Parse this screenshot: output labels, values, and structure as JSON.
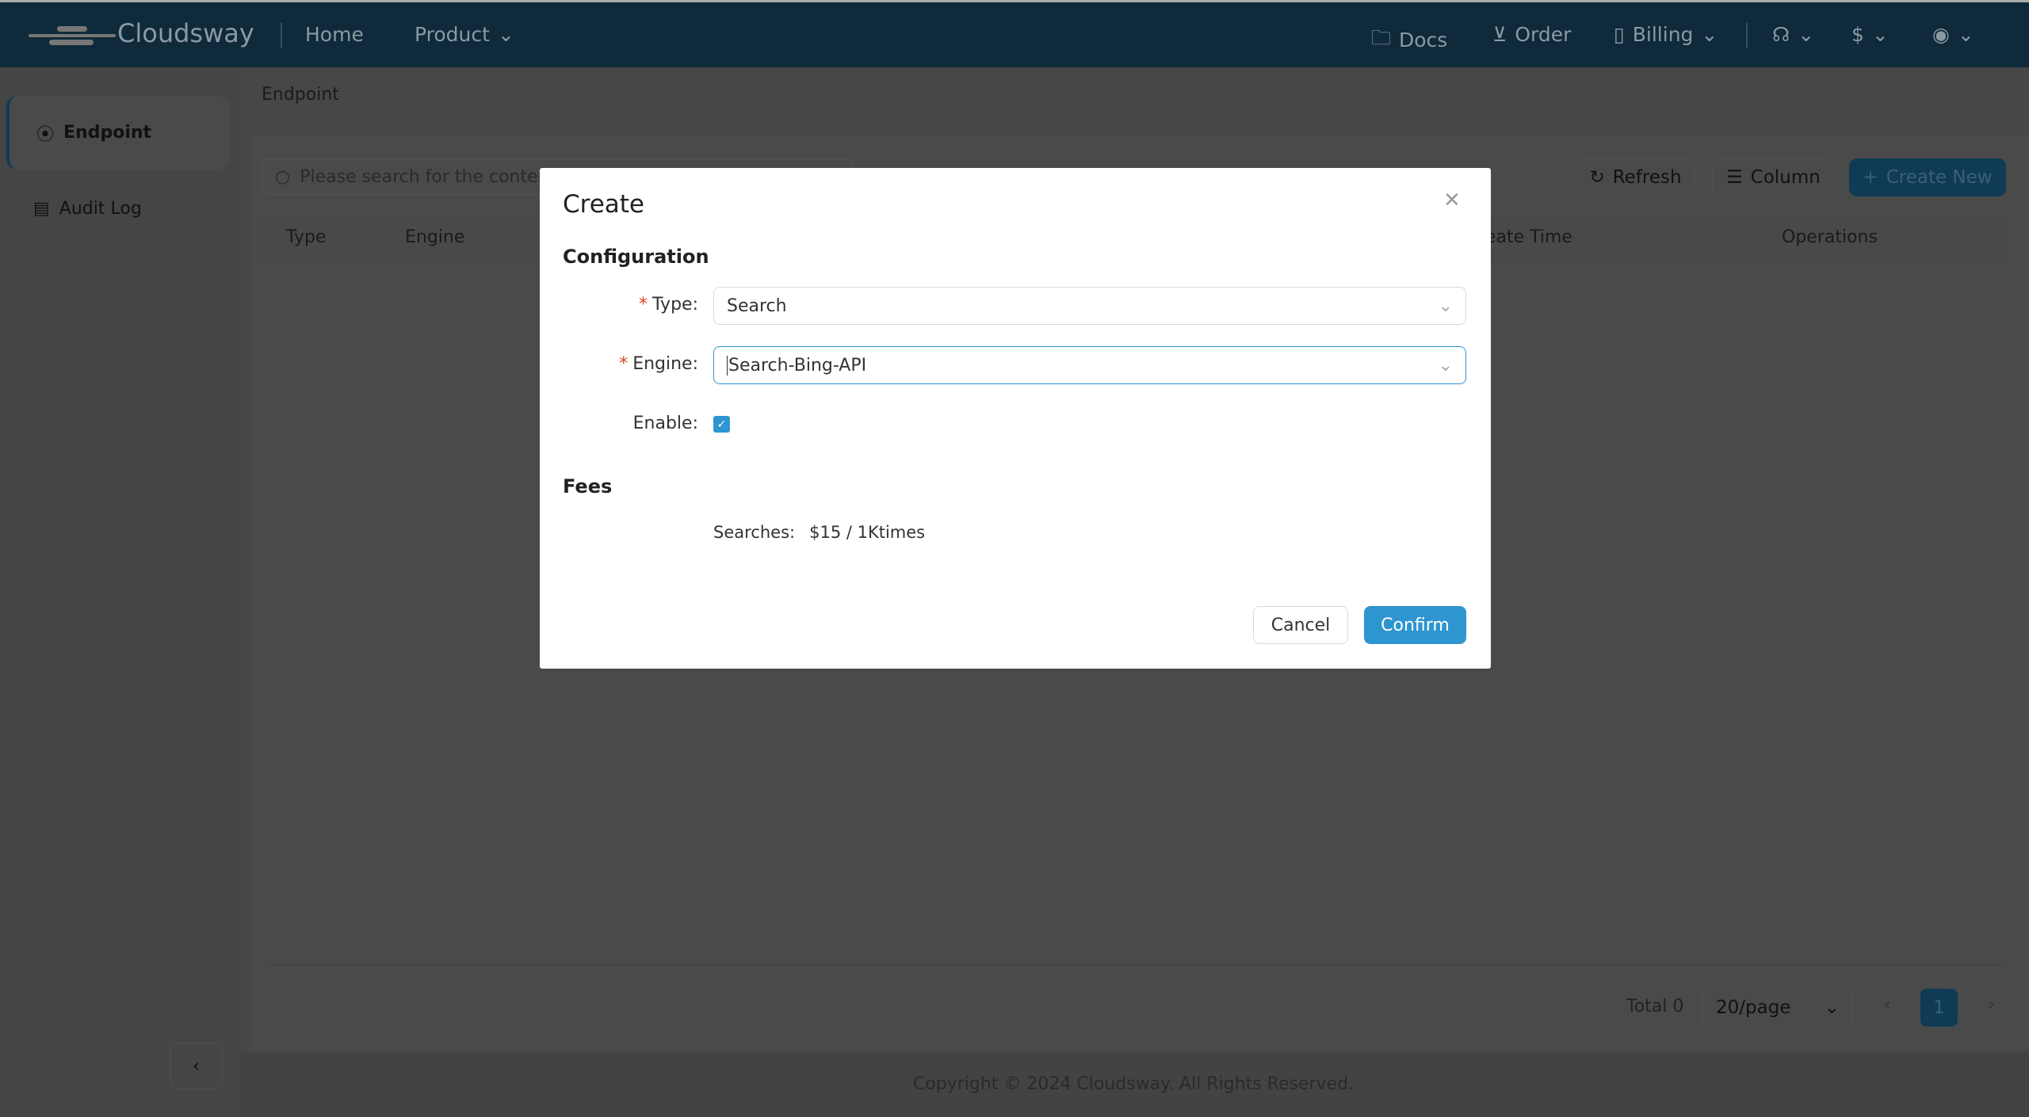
{
  "header": {
    "brand": "Cloudsway",
    "nav": [
      {
        "label": "Home"
      },
      {
        "label": "Product"
      }
    ],
    "right": [
      {
        "label": "Docs",
        "icon": "folder-icon"
      },
      {
        "label": "Order",
        "icon": "cart-icon"
      },
      {
        "label": "Billing",
        "icon": "bill-icon"
      }
    ],
    "icons": [
      "support-icon",
      "currency-icon",
      "user-icon"
    ]
  },
  "sidebar": {
    "items": [
      {
        "label": "Endpoint",
        "icon": "endpoint-icon",
        "selected": true
      },
      {
        "label": "Audit Log",
        "icon": "log-icon"
      }
    ]
  },
  "breadcrumb": "Endpoint",
  "toolbar": {
    "search_placeholder": "Please search for the content",
    "refresh": "Refresh",
    "column": "Column",
    "create_new": "Create New"
  },
  "table": {
    "columns": [
      "Type",
      "Engine",
      "Create Time",
      "Operations"
    ]
  },
  "pagination": {
    "total": "Total 0",
    "page_size": "20/page",
    "current_page": "1"
  },
  "footer": "Copyright © 2024 Cloudsway. All Rights Reserved.",
  "modal": {
    "title": "Create",
    "section_config": "Configuration",
    "type_label": "Type:",
    "type_value": "Search",
    "engine_label": "Engine:",
    "engine_value": "Search-Bing-API",
    "enable_label": "Enable:",
    "enabled": true,
    "section_fees": "Fees",
    "fee_label": "Searches:",
    "fee_value": "$15 / 1Ktimes",
    "cancel": "Cancel",
    "confirm": "Confirm"
  },
  "colors": {
    "accent": "#2f95d0",
    "header": "#0f2a3a",
    "primary_dark": "#0f3b55"
  }
}
